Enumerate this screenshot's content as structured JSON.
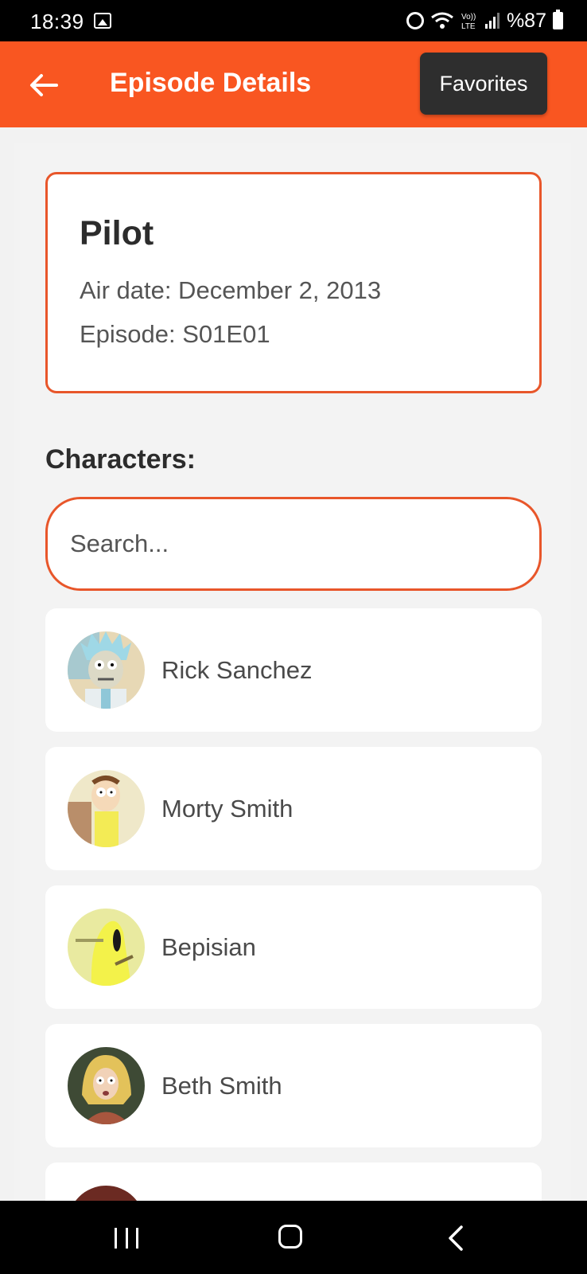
{
  "status_bar": {
    "time": "18:39",
    "battery": "%87",
    "icons": [
      "gallery-icon",
      "alarm-icon",
      "wifi-icon",
      "volte-icon",
      "signal-icon",
      "battery-icon"
    ]
  },
  "app_bar": {
    "title": "Episode Details",
    "favorites_label": "Favorites",
    "color": "#F95621",
    "back_icon": "arrow-left-icon"
  },
  "episode": {
    "name": "Pilot",
    "air_date": "Air date: December 2, 2013",
    "code": "Episode: S01E01"
  },
  "characters_section": {
    "heading": "Characters:",
    "search_placeholder": "Search...",
    "items": [
      {
        "name": "Rick Sanchez"
      },
      {
        "name": "Morty Smith"
      },
      {
        "name": "Bepisian"
      },
      {
        "name": "Beth Smith"
      },
      {
        "name": ""
      }
    ]
  },
  "nav_bar": {
    "icons": [
      "recents-icon",
      "home-icon",
      "back-icon"
    ]
  },
  "colors": {
    "accent": "#F95621",
    "border": "#E8562A",
    "dark_button": "#2E2E2E"
  }
}
